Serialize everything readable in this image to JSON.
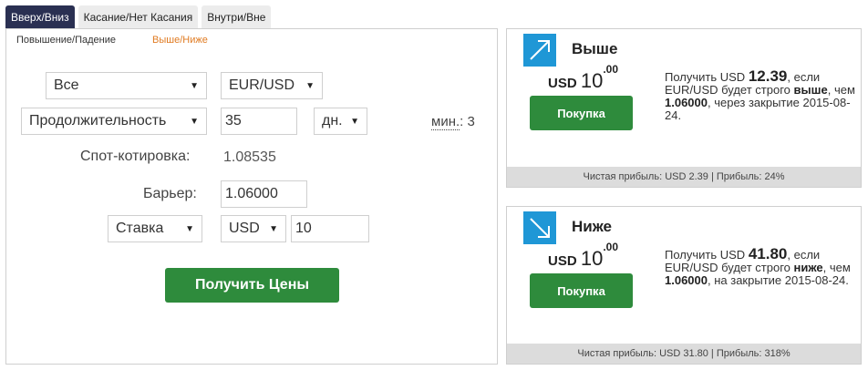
{
  "tabs": [
    {
      "label": "Вверх/Вниз",
      "active": true
    },
    {
      "label": "Касание/Нет Касания",
      "active": false
    },
    {
      "label": "Внутри/Вне",
      "active": false
    }
  ],
  "subtabs": [
    {
      "label": "Повышение/Падение",
      "active": false
    },
    {
      "label": "Выше/Ниже",
      "active": true
    }
  ],
  "form": {
    "market": "Все",
    "asset": "EUR/USD",
    "duration_type": "Продолжительность",
    "duration_value": "35",
    "duration_unit": "дн.",
    "min_label": "мин.",
    "min_value": ": 3",
    "spot_label": "Спот-котировка:",
    "spot_value": "1.08535",
    "barrier_label": "Барьер:",
    "barrier_value": "1.06000",
    "amount_type": "Ставка",
    "currency": "USD",
    "amount": "10",
    "get_prices_label": "Получить Цены"
  },
  "cards": {
    "higher": {
      "title": "Выше",
      "currency": "USD",
      "stake_int": "10",
      "stake_dec": ".00",
      "buy_label": "Покупка",
      "desc_prefix": "Получить USD",
      "payout": "12.39",
      "desc_middle": ", если EUR/USD будет строго",
      "direction": "выше",
      "desc_comma": ",",
      "desc_than": "чем",
      "barrier": "1.06000",
      "desc_suffix": ", через закрытие 2015-08-24.",
      "profit_text": "Чистая прибыль: USD 2.39 | Прибыль: 24%"
    },
    "lower": {
      "title": "Ниже",
      "currency": "USD",
      "stake_int": "10",
      "stake_dec": ".00",
      "buy_label": "Покупка",
      "desc_prefix": "Получить USD",
      "payout": "41.80",
      "desc_middle": ", если EUR/USD будет строго",
      "direction": "ниже",
      "desc_comma": ",",
      "desc_than": "чем",
      "barrier": "1.06000",
      "desc_suffix": ", на закрытие 2015-08-24.",
      "profit_text": "Чистая прибыль: USD 31.80 | Прибыль: 318%"
    }
  },
  "colors": {
    "active_tab": "#2a3052",
    "accent_orange": "#e07b22",
    "button_green": "#2e8b3c",
    "icon_blue": "#1f97d6"
  }
}
